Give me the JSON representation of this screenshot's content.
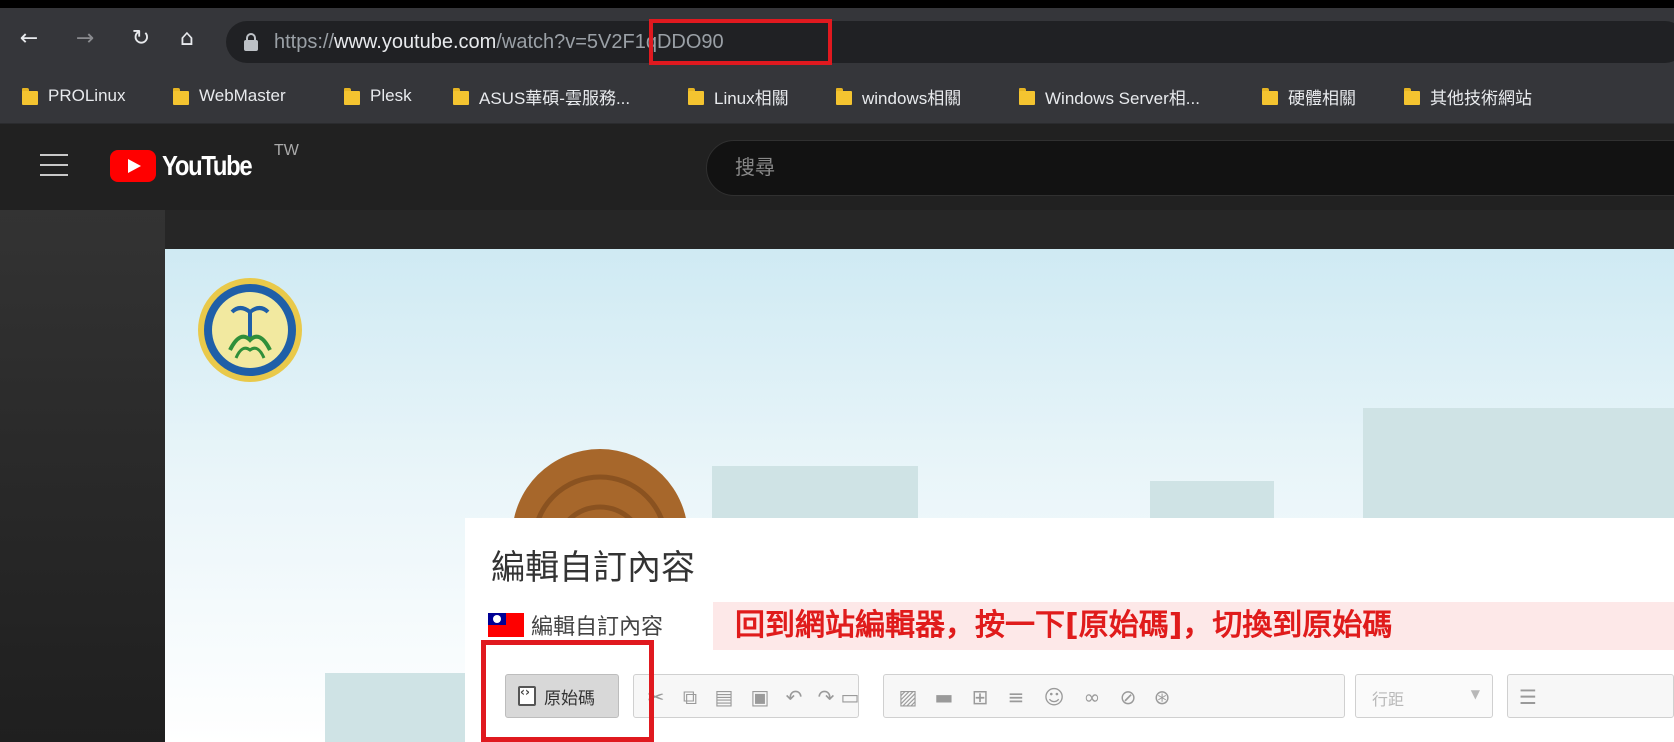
{
  "browser": {
    "url_prefix": "https://",
    "url_host": "www.youtube.com",
    "url_path": "/watch?v=5V2F1qDDO90",
    "bookmarks": [
      {
        "label": "PROLinux"
      },
      {
        "label": "WebMaster"
      },
      {
        "label": "Plesk"
      },
      {
        "label": "ASUS華碩-雲服務..."
      },
      {
        "label": "Linux相關"
      },
      {
        "label": "windows相關"
      },
      {
        "label": "Windows Server相..."
      },
      {
        "label": "硬體相關"
      },
      {
        "label": "其他技術網站"
      }
    ]
  },
  "youtube": {
    "logo_text": "YouTube",
    "region": "TW",
    "search_placeholder": "搜尋"
  },
  "editor": {
    "title": "編輯自訂內容",
    "subtitle": "編輯自訂內容",
    "annotation": "回到網站編輯器，按一下[原始碼]，切換到原始碼",
    "source_button_label": "原始碼",
    "line_spacing_label": "行距"
  },
  "colors": {
    "highlight_border": "#e0191f",
    "annotation_text": "#e01b1b",
    "youtube_red": "#ff0000",
    "browser_chrome": "#35363a"
  }
}
